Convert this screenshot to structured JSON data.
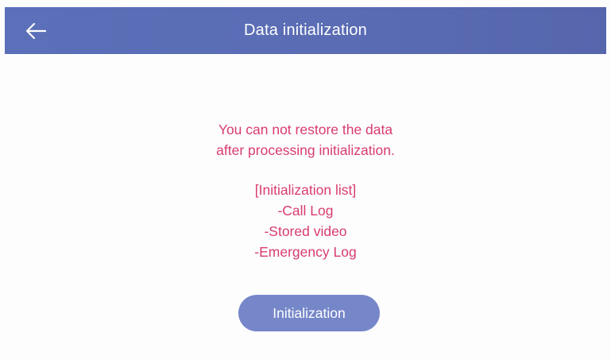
{
  "header": {
    "title": "Data initialization",
    "back_icon": "arrow-left-icon"
  },
  "message": {
    "line1": "You can not restore the data",
    "line2": "after processing initialization."
  },
  "list": {
    "heading": "[Initialization list]",
    "items": [
      "-Call Log",
      "-Stored video",
      "-Emergency Log"
    ]
  },
  "action": {
    "button_label": "Initialization"
  },
  "colors": {
    "header": "#5a6cb4",
    "text": "#d93c6d",
    "button": "#7687c9"
  }
}
